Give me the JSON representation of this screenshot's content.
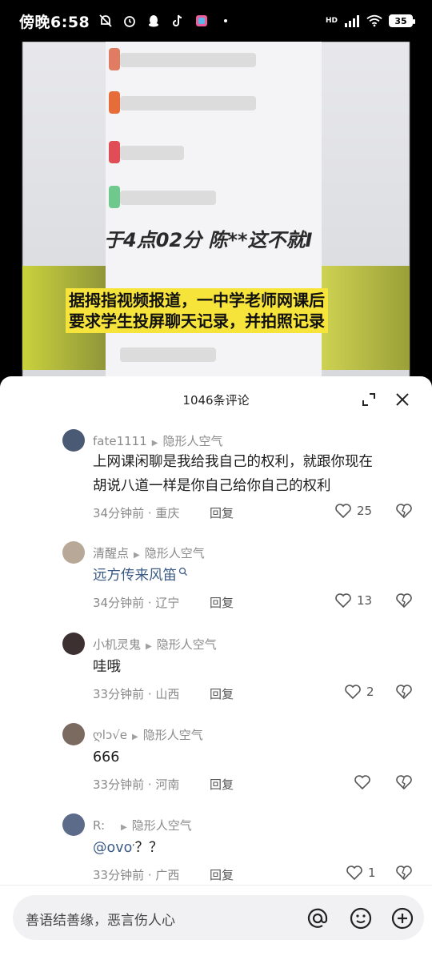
{
  "status": {
    "time": "傍晚6:58",
    "battery": "35",
    "network": "HD"
  },
  "video": {
    "overlay_text": "于4点02分 陈**这不就I",
    "caption_line1": "据拇指视频报道，一中学老师网课后",
    "caption_line2": "要求学生投屏聊天记录，并拍照记录"
  },
  "sheet": {
    "title": "1046条评论"
  },
  "comments": [
    {
      "user": "fate1111",
      "reply_to": "隐形人空气",
      "text_line1": "上网课闲聊是我给我自己的权利，就跟你现在",
      "text_line2": "胡说八道一样是你自己给你自己的权利",
      "time": "34分钟前",
      "location": "重庆",
      "reply_label": "回复",
      "likes": "25",
      "avatar_color": "#4b5a74"
    },
    {
      "user": "清醒点",
      "reply_to": "隐形人空气",
      "text_line1": "远方传来风笛",
      "time": "34分钟前",
      "location": "辽宁",
      "reply_label": "回复",
      "likes": "13",
      "avatar_color": "#b8a898"
    },
    {
      "user": "小机灵鬼",
      "reply_to": "隐形人空气",
      "text_line1": "哇哦",
      "time": "33分钟前",
      "location": "山西",
      "reply_label": "回复",
      "likes": "2",
      "avatar_color": "#3d3030"
    },
    {
      "user": "ღlɔ√e",
      "reply_to": "隐形人空气",
      "text_line1": "666",
      "time": "33分钟前",
      "location": "河南",
      "reply_label": "回复",
      "likes": "",
      "avatar_color": "#7a6a60"
    },
    {
      "user": "R:",
      "reply_to": "隐形人空气",
      "mention": "@ovo",
      "text_tail": "？？",
      "time": "33分钟前",
      "location": "广西",
      "reply_label": "回复",
      "likes": "1",
      "avatar_color": "#5d6b8a"
    }
  ],
  "input": {
    "placeholder": "善语结善缘，恶言伤人心"
  },
  "icons": {
    "at": "at-icon",
    "emoji": "emoji-icon",
    "add": "add-icon",
    "expand": "expand-icon",
    "close": "close-icon",
    "like": "heart-icon",
    "dislike": "broken-heart-icon"
  }
}
